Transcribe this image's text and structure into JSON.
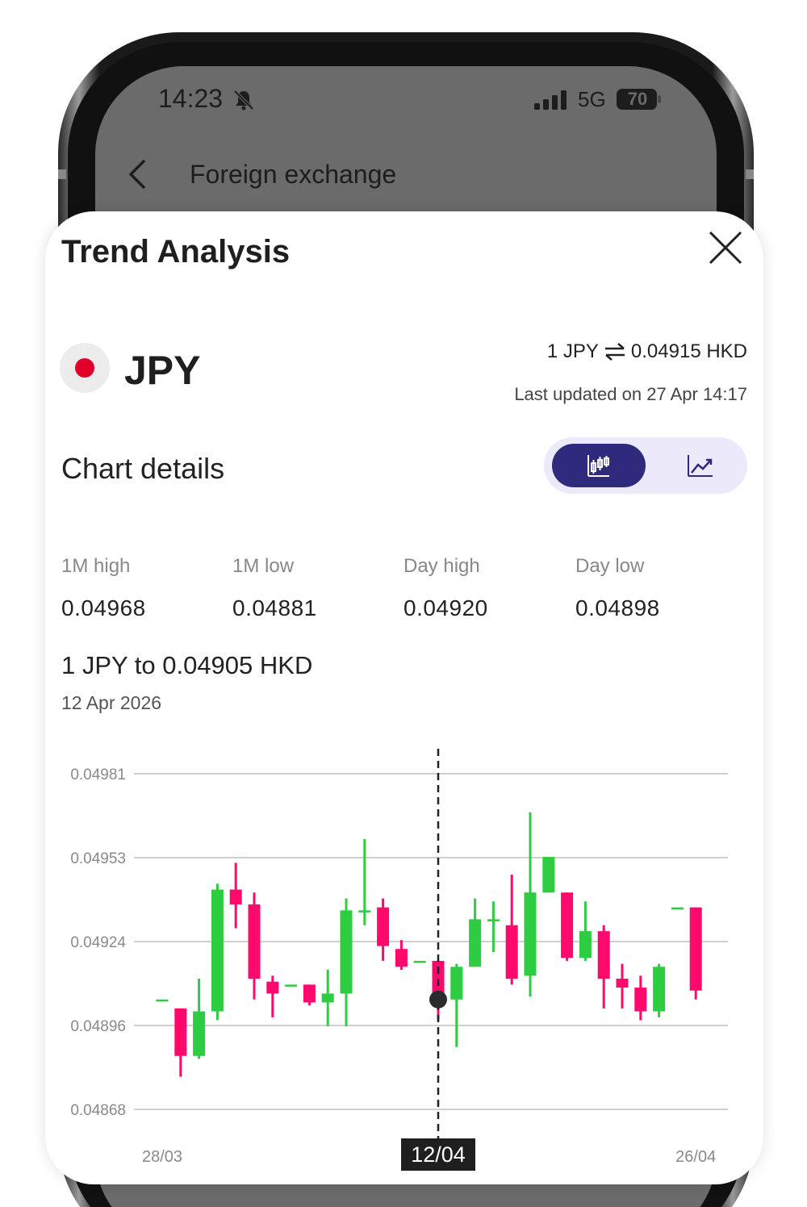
{
  "status_bar": {
    "time": "14:23",
    "network": "5G",
    "battery": "70"
  },
  "nav": {
    "title": "Foreign exchange"
  },
  "sheet": {
    "title": "Trend Analysis",
    "currency": "JPY",
    "rate_base": "1 JPY",
    "rate_value": "0.04915 HKD",
    "last_updated": "Last updated on 27 Apr 14:17",
    "section_title": "Chart details",
    "active_view": "candlestick",
    "stats": [
      {
        "label": "1M high",
        "value": "0.04968"
      },
      {
        "label": "1M low",
        "value": "0.04881"
      },
      {
        "label": "Day high",
        "value": "0.04920"
      },
      {
        "label": "Day low",
        "value": "0.04898"
      }
    ],
    "selected_rate": "1 JPY to 0.04905 HKD",
    "selected_date": "12 Apr 2026"
  },
  "colors": {
    "up": "#2ecc40",
    "down": "#ff0a6c",
    "toggle_active": "#2f2a7c",
    "toggle_bg": "#ece9fb"
  },
  "icons": {
    "bell": "bell-muted-icon",
    "signal": "signal-icon",
    "battery": "battery-icon",
    "back": "chevron-left-icon",
    "close": "close-icon",
    "flag": "japan-flag-icon",
    "swap": "swap-arrows-icon",
    "candle_view": "candlestick-chart-icon",
    "line_view": "line-chart-icon"
  },
  "chart_data": {
    "type": "candlestick",
    "y_ticks": [
      "0.04981",
      "0.04953",
      "0.04924",
      "0.04896",
      "0.04868"
    ],
    "ylim": [
      0.04868,
      0.04981
    ],
    "x_tick_labels": [
      "28/03",
      "12/04",
      "26/04"
    ],
    "x_tick_index": [
      0,
      15,
      29
    ],
    "highlight_index": 15,
    "highlight_label": "12/04",
    "highlight_value": 0.04905,
    "grid": true,
    "candles": [
      {
        "o": 0.04905,
        "c": 0.04905,
        "h": 0.04905,
        "l": 0.04905
      },
      {
        "o": 0.04902,
        "c": 0.04886,
        "h": 0.04902,
        "l": 0.04879
      },
      {
        "o": 0.04886,
        "c": 0.04901,
        "h": 0.04912,
        "l": 0.04885
      },
      {
        "o": 0.04901,
        "c": 0.04942,
        "h": 0.04944,
        "l": 0.04898
      },
      {
        "o": 0.04942,
        "c": 0.04937,
        "h": 0.04951,
        "l": 0.04929
      },
      {
        "o": 0.04937,
        "c": 0.04912,
        "h": 0.04941,
        "l": 0.04905
      },
      {
        "o": 0.04911,
        "c": 0.04907,
        "h": 0.04913,
        "l": 0.04899
      },
      {
        "o": 0.0491,
        "c": 0.0491,
        "h": 0.0491,
        "l": 0.0491
      },
      {
        "o": 0.0491,
        "c": 0.04904,
        "h": 0.0491,
        "l": 0.04903
      },
      {
        "o": 0.04904,
        "c": 0.04907,
        "h": 0.04915,
        "l": 0.04896
      },
      {
        "o": 0.04907,
        "c": 0.04935,
        "h": 0.04939,
        "l": 0.04896
      },
      {
        "o": 0.04935,
        "c": 0.04935,
        "h": 0.04959,
        "l": 0.0493
      },
      {
        "o": 0.04936,
        "c": 0.04923,
        "h": 0.04939,
        "l": 0.04918
      },
      {
        "o": 0.04922,
        "c": 0.04916,
        "h": 0.04925,
        "l": 0.04915
      },
      {
        "o": 0.04918,
        "c": 0.04918,
        "h": 0.04918,
        "l": 0.04918
      },
      {
        "o": 0.04918,
        "c": 0.04905,
        "h": 0.04918,
        "l": 0.04898
      },
      {
        "o": 0.04905,
        "c": 0.04916,
        "h": 0.04917,
        "l": 0.04889
      },
      {
        "o": 0.04916,
        "c": 0.04932,
        "h": 0.04939,
        "l": 0.04916
      },
      {
        "o": 0.04932,
        "c": 0.04932,
        "h": 0.04938,
        "l": 0.04921
      },
      {
        "o": 0.0493,
        "c": 0.04912,
        "h": 0.04947,
        "l": 0.0491
      },
      {
        "o": 0.04913,
        "c": 0.04941,
        "h": 0.04968,
        "l": 0.04906
      },
      {
        "o": 0.04941,
        "c": 0.04953,
        "h": 0.04953,
        "l": 0.04941
      },
      {
        "o": 0.04941,
        "c": 0.04919,
        "h": 0.04941,
        "l": 0.04918
      },
      {
        "o": 0.04919,
        "c": 0.04928,
        "h": 0.04938,
        "l": 0.04918
      },
      {
        "o": 0.04928,
        "c": 0.04912,
        "h": 0.0493,
        "l": 0.04902
      },
      {
        "o": 0.04912,
        "c": 0.04909,
        "h": 0.04917,
        "l": 0.04902
      },
      {
        "o": 0.04909,
        "c": 0.04901,
        "h": 0.04913,
        "l": 0.04898
      },
      {
        "o": 0.04901,
        "c": 0.04916,
        "h": 0.04917,
        "l": 0.04899
      },
      {
        "o": 0.04936,
        "c": 0.04936,
        "h": 0.04936,
        "l": 0.04936
      },
      {
        "o": 0.04936,
        "c": 0.04908,
        "h": 0.04936,
        "l": 0.04905
      }
    ]
  }
}
